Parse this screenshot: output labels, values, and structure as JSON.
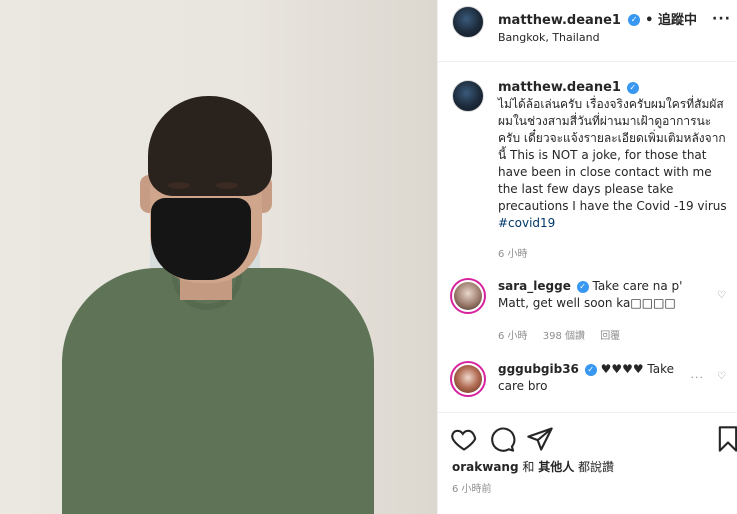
{
  "post": {
    "username": "matthew.deane1",
    "follow_status": "• 追蹤中",
    "location": "Bangkok, Thailand",
    "more_label": "···"
  },
  "caption": {
    "username": "matthew.deane1",
    "text": "ไม่ได้ล้อเล่นครับ เรื่องจริงครับผมใครที่สัมผัสผมในช่วงสามสี่วันที่ผ่านมาเฝ้าดูอาการนะครับ เดี๋ยวจะแจ้งรายละเอียดเพิ่มเติมหลังจากนี้ This is NOT a joke, for those that have been in close contact with me the last few days please take precautions I have the Covid -19 virus",
    "hashtag": "#covid19",
    "time": "6 小時"
  },
  "comments": [
    {
      "username": "sara_legge",
      "text": "Take care na p' Matt, get well soon ka□□□□",
      "time": "6 小時",
      "likes": "398 個讚",
      "reply": "回覆"
    },
    {
      "username": "gggubgib36",
      "text": "♥♥♥♥ Take care bro"
    }
  ],
  "footer": {
    "liked_by_user": "orakwang",
    "liked_by_rest_1": " 和 ",
    "liked_by_others": "其他人",
    "liked_by_rest_2": " 都說讚",
    "time_ago": "6 小時前"
  },
  "colors": {
    "verified": "#3897f0",
    "hashtag": "#00376b",
    "meta_gray": "#8e8e8e",
    "shirt": "#5f7457"
  },
  "icons": [
    "heart-icon",
    "comment-icon",
    "share-icon",
    "bookmark-icon",
    "verified-icon",
    "more-icon"
  ]
}
